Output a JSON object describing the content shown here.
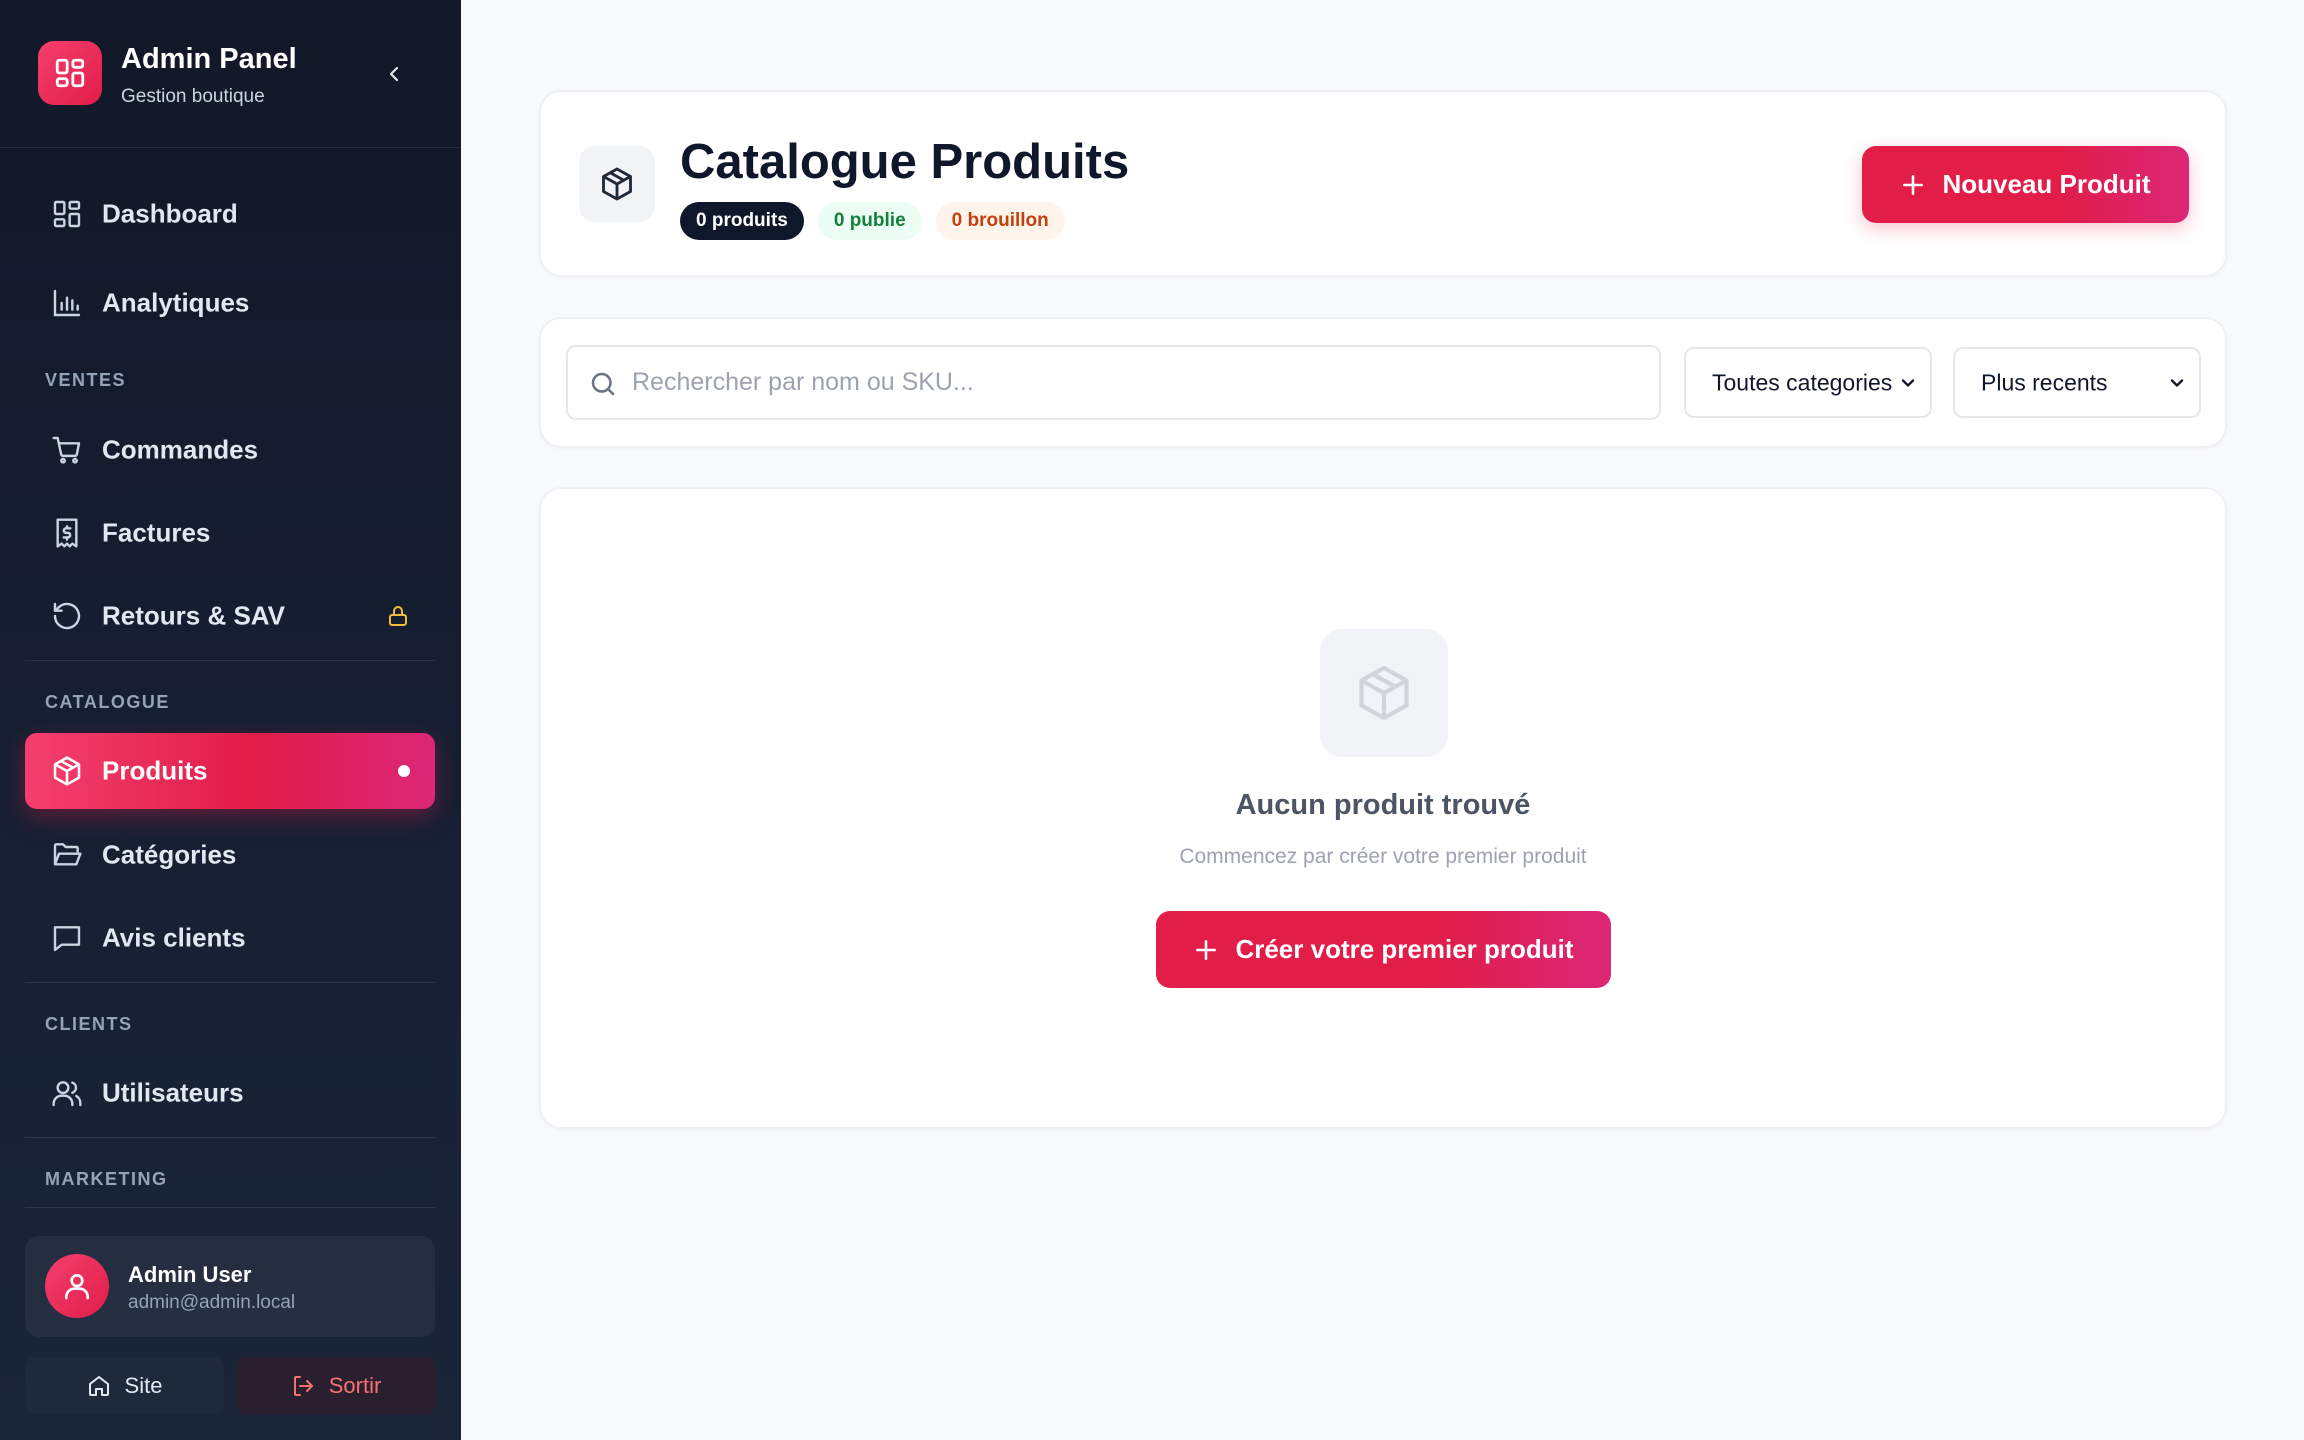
{
  "sidebar": {
    "brand": {
      "title": "Admin Panel",
      "subtitle": "Gestion boutique",
      "icon": "grid-icon"
    },
    "collapse_icon": "chevron-left-icon",
    "items": [
      {
        "label": "Dashboard",
        "icon": "grid-icon"
      },
      {
        "label": "Analytiques",
        "icon": "bar-chart-icon"
      },
      {
        "label": "Commandes",
        "icon": "cart-icon"
      },
      {
        "label": "Factures",
        "icon": "invoice-icon"
      },
      {
        "label": "Retours & SAV",
        "icon": "rotate-ccw-icon",
        "locked": true
      },
      {
        "label": "Produits",
        "icon": "box-icon",
        "active": true
      },
      {
        "label": "Catégories",
        "icon": "folder-icon"
      },
      {
        "label": "Avis clients",
        "icon": "message-square-icon"
      },
      {
        "label": "Utilisateurs",
        "icon": "users-icon"
      }
    ],
    "sections": [
      "VENTES",
      "CATALOGUE",
      "CLIENTS",
      "MARKETING"
    ],
    "user": {
      "name": "Admin User",
      "email": "admin@admin.local"
    },
    "footer": {
      "site_label": "Site",
      "logout_label": "Sortir"
    }
  },
  "header": {
    "title": "Catalogue Produits",
    "badges": {
      "products": "0 produits",
      "published": "0 publie",
      "draft": "0 brouillon"
    },
    "new_button": "Nouveau Produit"
  },
  "filters": {
    "search_placeholder": "Rechercher par nom ou SKU...",
    "search_value": "",
    "category_selected": "Toutes categories",
    "sort_selected": "Plus recents"
  },
  "empty_state": {
    "title": "Aucun produit trouvé",
    "subtitle": "Commencez par créer votre premier produit",
    "button": "Créer votre premier produit"
  },
  "colors": {
    "accent": "#e11d48",
    "sidebar_bg": "#111827",
    "page_bg": "#f8f9fb",
    "published": "#15803d",
    "draft": "#c2410c",
    "lock": "#f5b93b"
  }
}
